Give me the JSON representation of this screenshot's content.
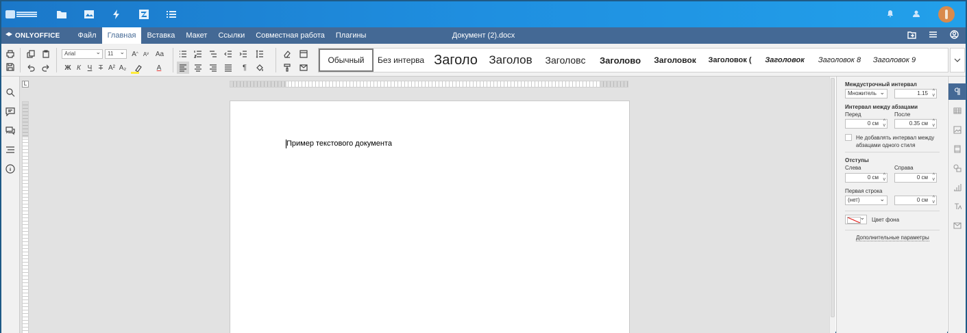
{
  "portal": {
    "icons": [
      "folder-icon",
      "image-icon",
      "lightning-icon",
      "zoom-app-icon",
      "list-icon"
    ],
    "right_icons": [
      "bell-icon",
      "people-icon"
    ]
  },
  "header": {
    "logo": "ONLYOFFICE",
    "tabs": [
      {
        "label": "Файл",
        "active": false
      },
      {
        "label": "Главная",
        "active": true
      },
      {
        "label": "Вставка",
        "active": false
      },
      {
        "label": "Макет",
        "active": false
      },
      {
        "label": "Ссылки",
        "active": false
      },
      {
        "label": "Совместная работа",
        "active": false
      },
      {
        "label": "Плагины",
        "active": false
      }
    ],
    "document_title": "Документ (2).docx"
  },
  "toolbar": {
    "font_name": "Arial",
    "font_size": "11",
    "bold": "Ж",
    "italic": "К",
    "underline": "Ч",
    "strike": "Т",
    "superscript": "A²",
    "subscript": "A₂",
    "font_color": "A",
    "grow_font": "A",
    "shrink_font": "A",
    "change_case": "Aa",
    "styles": [
      {
        "label": "Обычный",
        "size": 12,
        "weight": "normal",
        "italic": false,
        "selected": true
      },
      {
        "label": "Без интерва",
        "size": 12,
        "weight": "normal",
        "italic": false,
        "selected": false
      },
      {
        "label": "Заголо",
        "size": 20,
        "weight": "normal",
        "italic": false,
        "selected": false
      },
      {
        "label": "Заголов",
        "size": 17,
        "weight": "normal",
        "italic": false,
        "selected": false
      },
      {
        "label": "Заголовс",
        "size": 14,
        "weight": "normal",
        "italic": false,
        "selected": false
      },
      {
        "label": "Заголово",
        "size": 13,
        "weight": "bold",
        "italic": false,
        "selected": false
      },
      {
        "label": "Заголовок",
        "size": 12,
        "weight": "bold",
        "italic": false,
        "selected": false
      },
      {
        "label": "Заголовок (",
        "size": 11,
        "weight": "bold",
        "italic": false,
        "selected": false
      },
      {
        "label": "Заголовок",
        "size": 11,
        "weight": "bold",
        "italic": true,
        "selected": false
      },
      {
        "label": "Заголовок 8",
        "size": 11,
        "weight": "normal",
        "italic": true,
        "selected": false
      },
      {
        "label": "Заголовок 9",
        "size": 11,
        "weight": "normal",
        "italic": true,
        "selected": false
      }
    ]
  },
  "document": {
    "text": "Пример текстового документа"
  },
  "ruler": {
    "tab_stop_symbol": "L"
  },
  "paragraph_settings": {
    "line_spacing_title": "Междустрочный интервал",
    "line_spacing_mode": "Множитель",
    "line_spacing_value": "1.15",
    "para_spacing_title": "Интервал между абзацами",
    "before_label": "Перед",
    "after_label": "После",
    "before_value": "0 см",
    "after_value": "0.35 см",
    "dont_add_spacing_label": "Не добавлять интервал между абзацами одного стиля",
    "dont_add_spacing_checked": false,
    "indents_title": "Отступы",
    "left_label": "Слева",
    "right_label": "Справа",
    "left_value": "0 см",
    "right_value": "0 см",
    "first_line_label": "Первая строка",
    "first_line_mode": "(нет)",
    "first_line_value": "0 см",
    "background_color_label": "Цвет фона",
    "advanced_link": "Дополнительные параметры"
  },
  "colors": {
    "portal_bar": "#1f8fe0",
    "editor_header": "#446995",
    "avatar": "#d98a4b",
    "toolbar_bg": "#f1f1f1",
    "canvas_bg": "#e2e2e2"
  }
}
